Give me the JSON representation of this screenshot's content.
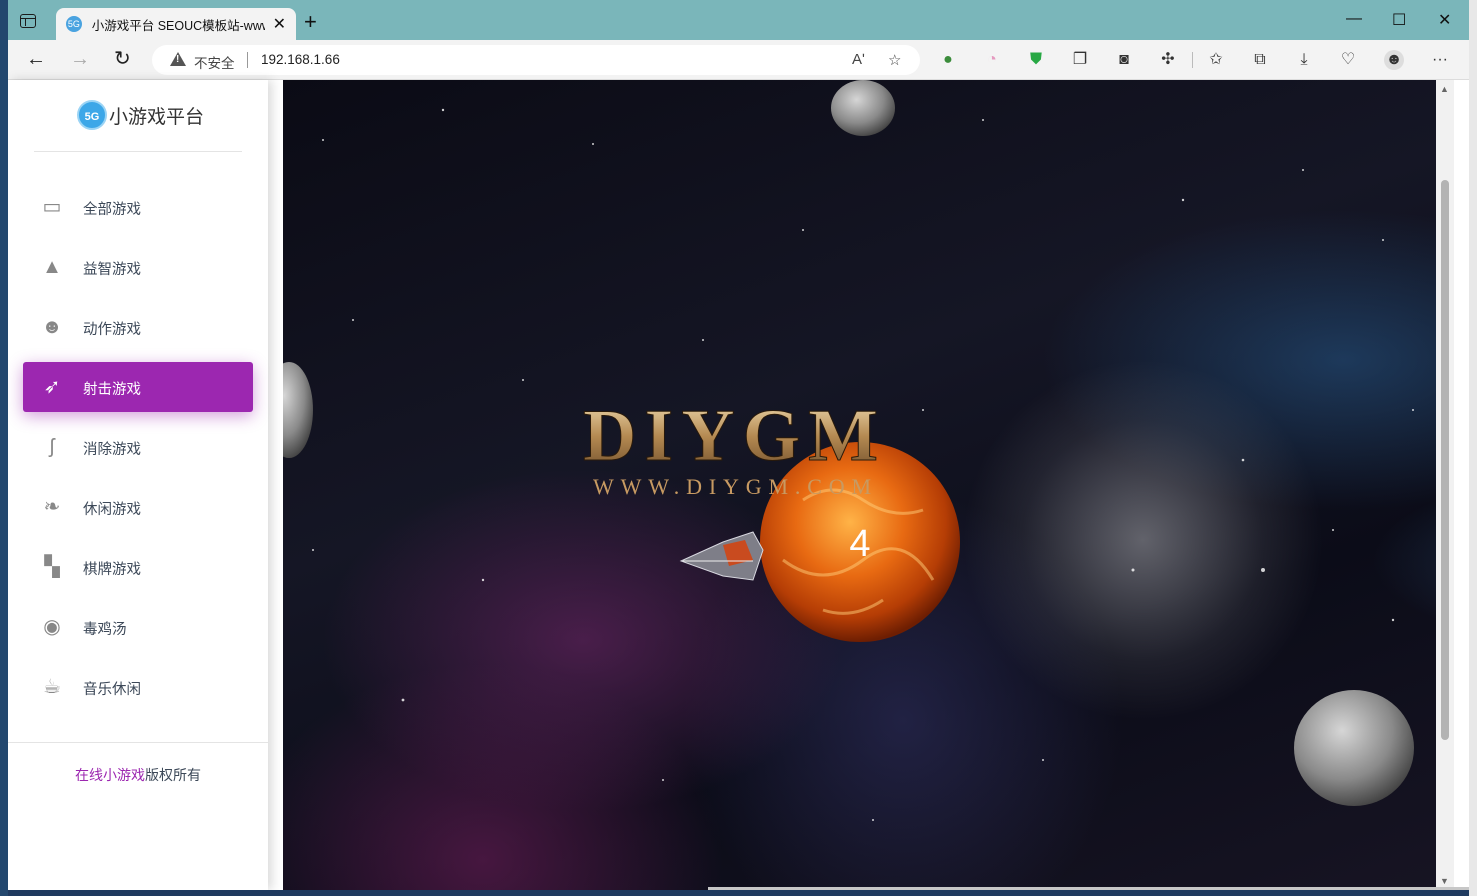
{
  "browser": {
    "tab_title": "小游戏平台 SEOUC模板站-www.a",
    "tab_favicon": "5G",
    "close_tab": "✕",
    "new_tab": "+",
    "minimize": "—",
    "maximize": "☐",
    "close_window": "✕",
    "insecure_label": "不安全",
    "url": "192.168.1.66",
    "read_aloud": "Aʹ",
    "more": "···"
  },
  "sidebar": {
    "logo_badge": "5G",
    "logo_text": "小游戏平台",
    "items": [
      {
        "label": "全部游戏",
        "icon": "twitch-icon"
      },
      {
        "label": "益智游戏",
        "icon": "graduation-cap-icon"
      },
      {
        "label": "动作游戏",
        "icon": "reddit-robot-icon"
      },
      {
        "label": "射击游戏",
        "icon": "rocket-icon",
        "active": true
      },
      {
        "label": "消除游戏",
        "icon": "symfony-icon"
      },
      {
        "label": "休闲游戏",
        "icon": "envira-leaf-icon"
      },
      {
        "label": "棋牌游戏",
        "icon": "chessboard-icon"
      },
      {
        "label": "毒鸡汤",
        "icon": "user-circle-icon"
      },
      {
        "label": "音乐休闲",
        "icon": "coffee-icon"
      }
    ],
    "copyright_link": "在线小游戏",
    "copyright_rest": "版权所有"
  },
  "game": {
    "logo_main": "DIYGM",
    "logo_url": "WWW.DIYGM.COM",
    "countdown": "4"
  },
  "colors": {
    "accent": "#9c27b0",
    "titlebar": "#7ab6ba"
  }
}
